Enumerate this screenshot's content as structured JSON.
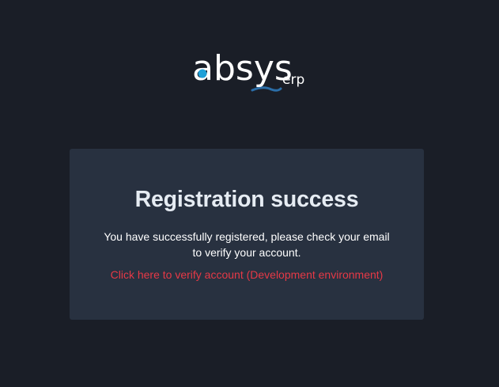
{
  "brand": {
    "word": "absys",
    "suffix": "erp",
    "accent_color": "#1ea0d8",
    "wave_color": "#2b6ea8"
  },
  "card": {
    "title": "Registration success",
    "message_line1": "You have successfully registered, please check your email",
    "message_line2": "to verify your account.",
    "verify_link": "Click here to verify account (Development environment)"
  },
  "colors": {
    "background": "#1a1e27",
    "card": "#283140",
    "link": "#e63946"
  }
}
